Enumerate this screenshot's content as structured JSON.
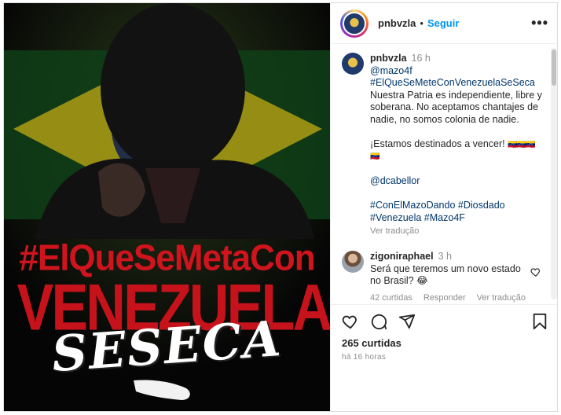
{
  "image": {
    "hashtag_line": "#ElQueSeMetaCon",
    "country_line": "VENEZUELA",
    "slogan_line": "SESECA",
    "colors": {
      "red": "#c5121b",
      "flag_green": "#1f7a2a",
      "flag_yellow": "#d9c21e"
    }
  },
  "header": {
    "username": "pnbvzla",
    "separator": "•",
    "follow_label": "Seguir",
    "more_label": "•••"
  },
  "caption": {
    "username": "pnbvzla",
    "time": "16 h",
    "mention": "@mazo4f",
    "hashtag_main": "#ElQueSeMeteConVenezuelaSeSeca",
    "text": "Nuestra Patria es independiente, libre y soberana. No aceptamos chantajes de nadie, no somos colonia de nadie.",
    "closing": "¡Estamos destinados a vencer!",
    "flags": "🇻🇪🇻🇪🇻🇪",
    "flag_last": "🇻🇪",
    "mention2": "@dcabellor",
    "tags_line1": "#ConElMazoDando #Diosdado",
    "tags_line2": "#Venezuela #Mazo4F",
    "translate": "Ver tradução"
  },
  "reply": {
    "username": "zigoniraphael",
    "time": "3 h",
    "text": "Será que teremos um novo estado no Brasil? 😂",
    "likes": "42 curtidas",
    "reply_label": "Responder",
    "translate": "Ver tradução"
  },
  "footer": {
    "likes": "265 curtidas",
    "ago": "há 16 horas"
  },
  "icons": [
    "heart-icon",
    "comment-icon",
    "share-icon",
    "bookmark-icon",
    "more-icon"
  ]
}
